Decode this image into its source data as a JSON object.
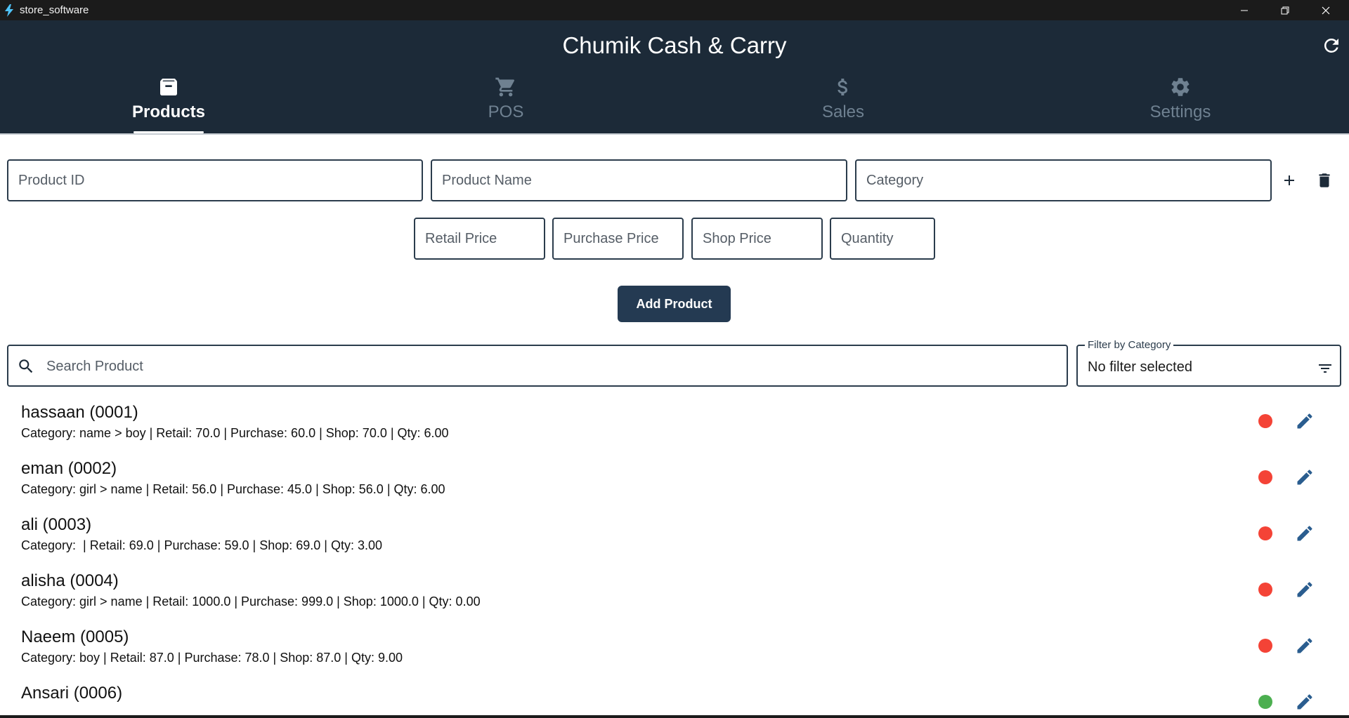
{
  "window": {
    "title": "store_software"
  },
  "header": {
    "app_title": "Chumik Cash & Carry",
    "tabs": [
      {
        "label": "Products",
        "icon": "archive-icon",
        "active": true
      },
      {
        "label": "POS",
        "icon": "cart-icon",
        "active": false
      },
      {
        "label": "Sales",
        "icon": "dollar-icon",
        "active": false
      },
      {
        "label": "Settings",
        "icon": "gear-icon",
        "active": false
      }
    ]
  },
  "form": {
    "product_id_placeholder": "Product ID",
    "product_name_placeholder": "Product Name",
    "category_placeholder": "Category",
    "retail_price_placeholder": "Retail Price",
    "purchase_price_placeholder": "Purchase Price",
    "shop_price_placeholder": "Shop Price",
    "quantity_placeholder": "Quantity",
    "add_product_label": "Add Product"
  },
  "search": {
    "placeholder": "Search Product"
  },
  "filter": {
    "label": "Filter by Category",
    "value": "No filter selected"
  },
  "colors": {
    "header_bg": "#1c2a38",
    "accent": "#243a52",
    "status_red": "#f44336",
    "status_green": "#4caf50",
    "edit_icon": "#2a5d8f"
  },
  "products": [
    {
      "title": "hassaan (0001)",
      "details": "Category: name > boy | Retail: 70.0 | Purchase: 60.0 | Shop: 70.0 | Qty: 6.00",
      "status": "red"
    },
    {
      "title": "eman (0002)",
      "details": "Category: girl > name | Retail: 56.0 | Purchase: 45.0 | Shop: 56.0 | Qty: 6.00",
      "status": "red"
    },
    {
      "title": "ali (0003)",
      "details": "Category:  | Retail: 69.0 | Purchase: 59.0 | Shop: 69.0 | Qty: 3.00",
      "status": "red"
    },
    {
      "title": "alisha (0004)",
      "details": "Category: girl > name | Retail: 1000.0 | Purchase: 999.0 | Shop: 1000.0 | Qty: 0.00",
      "status": "red"
    },
    {
      "title": "Naeem (0005)",
      "details": "Category: boy | Retail: 87.0 | Purchase: 78.0 | Shop: 87.0 | Qty: 9.00",
      "status": "red"
    },
    {
      "title": "Ansari (0006)",
      "details": "",
      "status": "green"
    }
  ]
}
